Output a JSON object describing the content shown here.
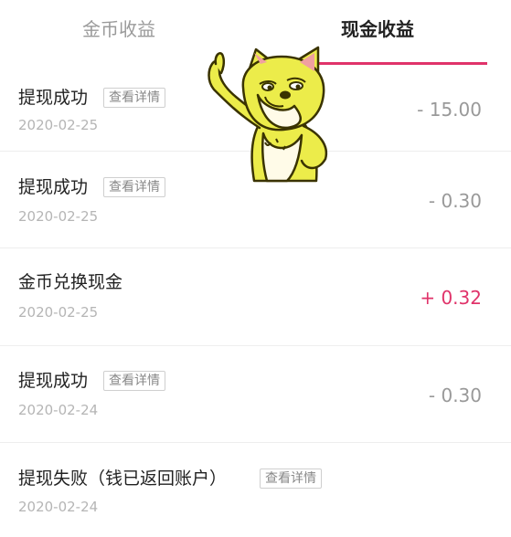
{
  "tabs": {
    "coin_label": "金币收益",
    "cash_label": "现金收益",
    "active": "cash",
    "accent_color": "#e0336a"
  },
  "records": [
    {
      "title": "提现成功",
      "detail_label": "查看详情",
      "date": "2020-02-25",
      "amount": "- 15.00"
    },
    {
      "title": "提现成功",
      "detail_label": "查看详情",
      "date": "2020-02-25",
      "amount": "- 0.30"
    },
    {
      "title": "金币兑换现金",
      "detail_label": "",
      "date": "2020-02-25",
      "amount": "+ 0.32"
    },
    {
      "title": "提现成功",
      "detail_label": "查看详情",
      "date": "2020-02-24",
      "amount": "- 0.30"
    },
    {
      "title": "提现失败（钱已返回账户）",
      "detail_label": "查看详情",
      "date": "2020-02-24",
      "amount": ""
    }
  ],
  "sticker": {
    "icon": "doge-sticker-icon"
  }
}
